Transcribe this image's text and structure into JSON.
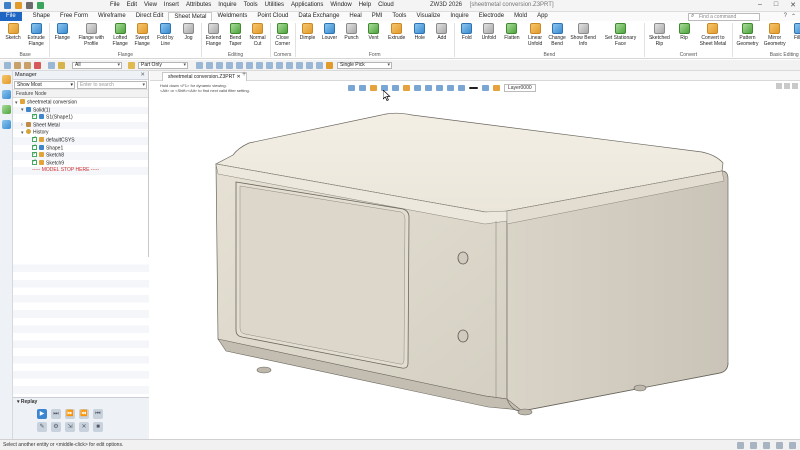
{
  "titlebar": {
    "menus": [
      "File",
      "Edit",
      "View",
      "Insert",
      "Attributes",
      "Inquire",
      "Tools",
      "Utilities",
      "Applications",
      "Window",
      "Help",
      "Cloud"
    ],
    "app_title": "ZW3D 2026",
    "doc_title": "[sheetmetal conversion.Z3PRT]"
  },
  "ribbon_tabs": [
    "File",
    "Shape",
    "Free Form",
    "Wireframe",
    "Direct Edit",
    "Sheet Metal",
    "Weldments",
    "Point Cloud",
    "Data Exchange",
    "Heal",
    "PMI",
    "Tools",
    "Visualize",
    "Inquire",
    "Electrode",
    "Mold",
    "App"
  ],
  "active_tab": "Sheet Metal",
  "find_placeholder": "Find a command",
  "ribbon_groups": [
    {
      "label": "Base",
      "buttons": [
        {
          "l1": "Sketch",
          "l2": "",
          "icon": "sketch-icon"
        },
        {
          "l1": "Extrude",
          "l2": "Flange",
          "icon": "extrude-flange-icon"
        }
      ]
    },
    {
      "label": "Flange",
      "buttons": [
        {
          "l1": "Flange",
          "l2": "",
          "icon": "flange-icon"
        },
        {
          "l1": "Flange with",
          "l2": "Profile",
          "icon": "flange-profile-icon"
        },
        {
          "l1": "Lofted",
          "l2": "Flange",
          "icon": "lofted-flange-icon"
        },
        {
          "l1": "Swept",
          "l2": "Flange",
          "icon": "swept-flange-icon"
        },
        {
          "l1": "Fold by",
          "l2": "Line",
          "icon": "fold-line-icon"
        },
        {
          "l1": "Jog",
          "l2": "",
          "icon": "jog-icon"
        }
      ]
    },
    {
      "label": "Editing",
      "buttons": [
        {
          "l1": "Extend",
          "l2": "Flange",
          "icon": "extend-flange-icon"
        },
        {
          "l1": "Bend",
          "l2": "Taper",
          "icon": "bend-taper-icon"
        },
        {
          "l1": "Normal",
          "l2": "Cut",
          "icon": "normal-cut-icon"
        }
      ]
    },
    {
      "label": "Corners",
      "buttons": [
        {
          "l1": "Close",
          "l2": "Corner",
          "icon": "close-corner-icon"
        }
      ]
    },
    {
      "label": "Form",
      "buttons": [
        {
          "l1": "Dimple",
          "l2": "",
          "icon": "dimple-icon"
        },
        {
          "l1": "Louver",
          "l2": "",
          "icon": "louver-icon"
        },
        {
          "l1": "Punch",
          "l2": "",
          "icon": "punch-icon"
        },
        {
          "l1": "Vent",
          "l2": "",
          "icon": "vent-icon"
        },
        {
          "l1": "Extrude",
          "l2": "",
          "icon": "extrude-icon"
        },
        {
          "l1": "Hole",
          "l2": "",
          "icon": "hole-icon"
        },
        {
          "l1": "Add",
          "l2": "",
          "icon": "add-icon"
        }
      ]
    },
    {
      "label": "Bend",
      "buttons": [
        {
          "l1": "Fold",
          "l2": "",
          "icon": "fold-icon"
        },
        {
          "l1": "Unfold",
          "l2": "",
          "icon": "unfold-icon"
        },
        {
          "l1": "Flatten",
          "l2": "",
          "icon": "flatten-icon"
        },
        {
          "l1": "Linear",
          "l2": "Unfold",
          "icon": "linear-unfold-icon"
        },
        {
          "l1": "Change",
          "l2": "Bend",
          "icon": "change-bend-icon"
        },
        {
          "l1": "Show Bend",
          "l2": "Info",
          "icon": "bend-info-icon"
        },
        {
          "l1": "Set Stationary",
          "l2": "Face",
          "icon": "stationary-face-icon"
        }
      ]
    },
    {
      "label": "Convert",
      "buttons": [
        {
          "l1": "Sketched",
          "l2": "Rip",
          "icon": "sketched-rip-icon"
        },
        {
          "l1": "Rip",
          "l2": "",
          "icon": "rip-icon"
        },
        {
          "l1": "Convert to",
          "l2": "Sheet Metal",
          "icon": "convert-icon"
        }
      ]
    },
    {
      "label": "Basic Editing",
      "buttons": [
        {
          "l1": "Pattern",
          "l2": "Geometry",
          "icon": "pattern-icon"
        },
        {
          "l1": "Mirror",
          "l2": "Geometry",
          "icon": "mirror-icon"
        },
        {
          "l1": "Fillet",
          "l2": "",
          "icon": "fillet-icon"
        },
        {
          "l1": "Chamfer",
          "l2": "",
          "icon": "chamfer-icon"
        }
      ]
    }
  ],
  "quickbar": {
    "filter_value": "All",
    "part_filter": "Part Only",
    "pick_mode": "Single Pick"
  },
  "manager": {
    "title": "Manager",
    "filter_value": "Show Most",
    "search_placeholder": "Enter to search",
    "feature_header": "Feature Node",
    "tree": [
      {
        "indent": 0,
        "twisty": "▾",
        "icon": "part",
        "check": false,
        "label": "sheetmetal conversion",
        "stop": false
      },
      {
        "indent": 1,
        "twisty": "▾",
        "icon": "solid",
        "check": false,
        "label": "Solid(1)",
        "stop": false
      },
      {
        "indent": 2,
        "twisty": "",
        "icon": "solid",
        "check": true,
        "label": "S1(Shape1)",
        "stop": false
      },
      {
        "indent": 1,
        "twisty": "›",
        "icon": "sheet",
        "check": false,
        "label": "Sheet Metal",
        "stop": false
      },
      {
        "indent": 1,
        "twisty": "▾",
        "icon": "hist",
        "check": false,
        "label": "History",
        "stop": false
      },
      {
        "indent": 2,
        "twisty": "",
        "icon": "csys",
        "check": true,
        "label": "defaultCSYS",
        "stop": false
      },
      {
        "indent": 2,
        "twisty": "",
        "icon": "shape",
        "check": true,
        "label": "Shape1",
        "stop": false
      },
      {
        "indent": 2,
        "twisty": "",
        "icon": "sketch",
        "check": true,
        "label": "Sketch8",
        "stop": false
      },
      {
        "indent": 2,
        "twisty": "",
        "icon": "sketch",
        "check": true,
        "label": "Sketch9",
        "stop": false
      },
      {
        "indent": 2,
        "twisty": "",
        "icon": "stop",
        "check": false,
        "label": "----- MODEL STOP HERE -----",
        "stop": true
      }
    ],
    "replay_title": "Replay"
  },
  "document_tab": "sheetmetal conversion.Z3PRT",
  "viewport": {
    "hint_line1": "Hold down <F1> for dynamic viewing.",
    "hint_line2": "<Alt> or <Shift><Alt> to find next valid filter setting.",
    "layer": "Layer0000"
  },
  "status_text": "Select another entity or <middle-click> for edit options."
}
